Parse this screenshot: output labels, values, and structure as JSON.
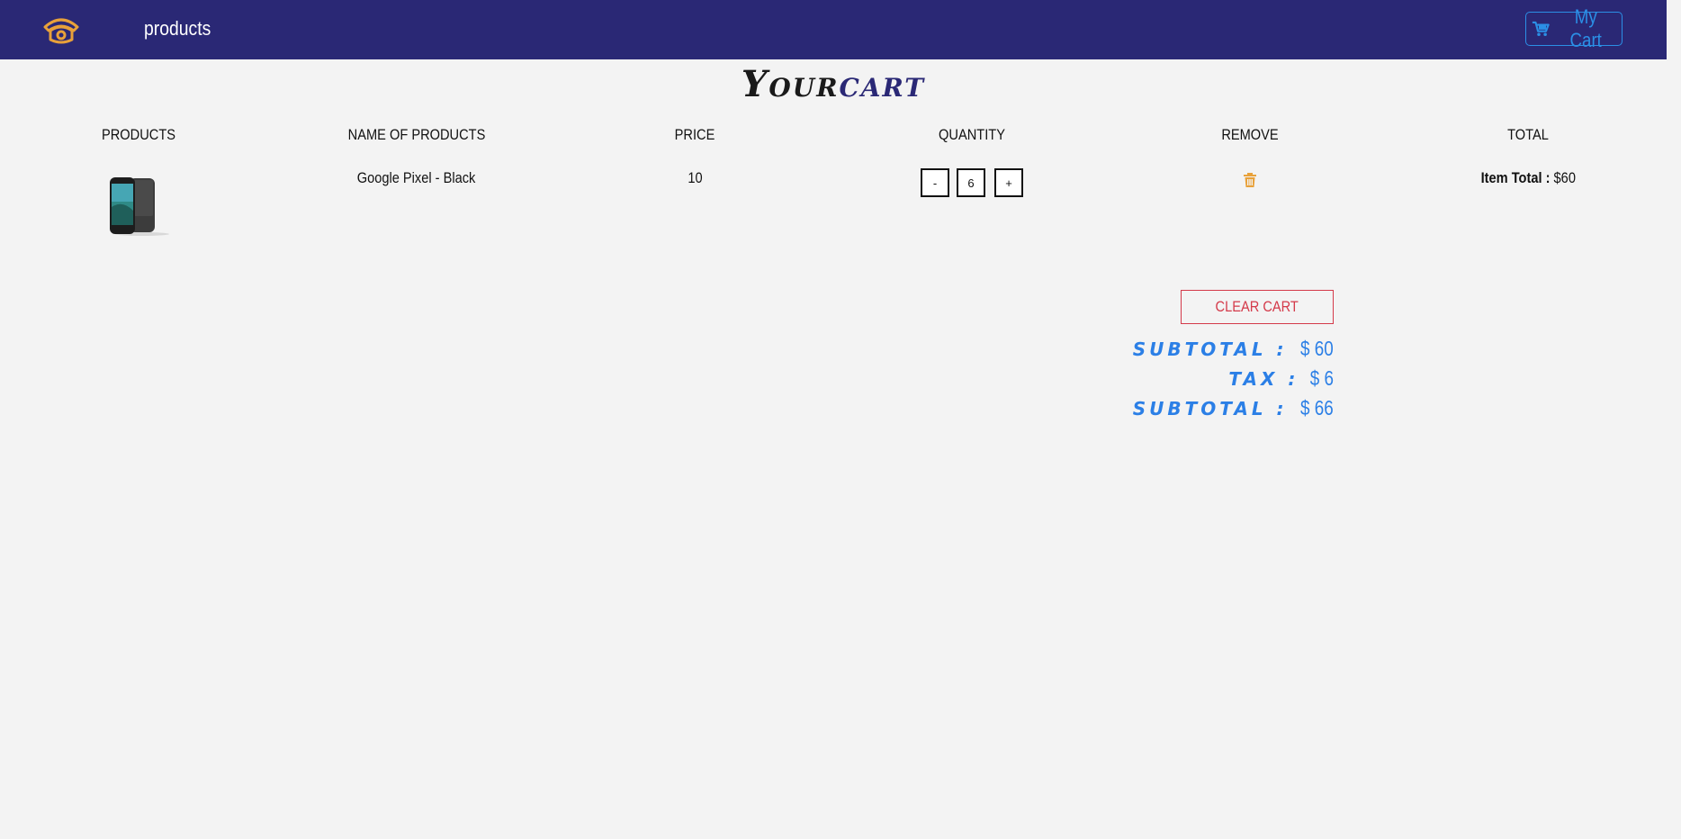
{
  "nav": {
    "logo_icon": "phone-logo-icon",
    "products_link": "products",
    "cart_button_label": "My Cart",
    "cart_icon": "cart-icon",
    "bar_color": "#2a2875",
    "accent": "#2b8fe6"
  },
  "page": {
    "title_word1": "Your",
    "title_word2": "cart"
  },
  "columns": [
    "products",
    "name of products",
    "price",
    "quantity",
    "remove",
    "total"
  ],
  "items": [
    {
      "image_icon": "google-pixel-phone-image",
      "name": "Google Pixel - Black",
      "price": "10",
      "decrement_label": "-",
      "quantity": "6",
      "increment_label": "+",
      "remove_icon": "trash-icon",
      "total_label": "Item Total :",
      "total_value": "$60"
    }
  ],
  "cart_summary": {
    "clear_label": "clear cart",
    "subtotal_label": "subtotal :",
    "subtotal_value": "$ 60",
    "tax_label": "tax :",
    "tax_value": "$ 6",
    "total_label": "subtotal :",
    "total_value": "$ 66",
    "summary_color": "#2b7fe6",
    "clear_color": "#d43a4a"
  }
}
